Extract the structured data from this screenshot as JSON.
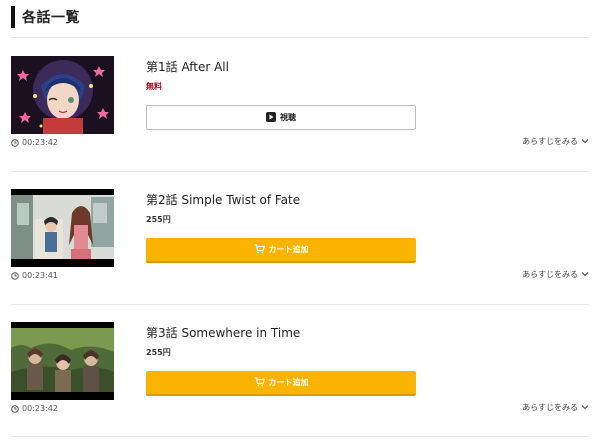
{
  "section": {
    "title": "各話一覧"
  },
  "episodes": [
    {
      "title": "第1話 After All",
      "price": "無料",
      "price_type": "free",
      "button": {
        "type": "watch",
        "label": "視聴",
        "icon": "play-icon"
      },
      "duration": "00:23:42",
      "synopsis_label": "あらすじをみる"
    },
    {
      "title": "第2話 Simple Twist of Fate",
      "price": "255円",
      "price_type": "paid",
      "button": {
        "type": "cart",
        "label": "カート追加",
        "icon": "cart-icon"
      },
      "duration": "00:23:41",
      "synopsis_label": "あらすじをみる"
    },
    {
      "title": "第3話 Somewhere in Time",
      "price": "255円",
      "price_type": "paid",
      "button": {
        "type": "cart",
        "label": "カート追加",
        "icon": "cart-icon"
      },
      "duration": "00:23:42",
      "synopsis_label": "あらすじをみる"
    }
  ],
  "colors": {
    "accent": "#f9b300",
    "free_price": "#c0001f",
    "divider": "#e9e9e9"
  }
}
